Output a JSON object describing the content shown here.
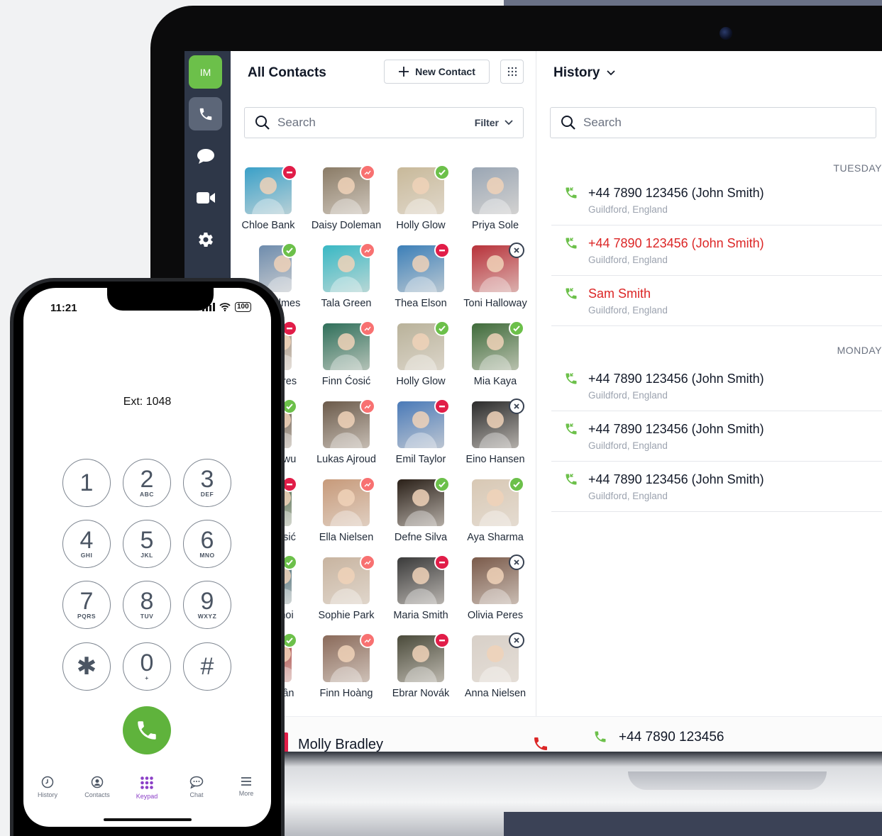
{
  "laptop": {
    "sidebar": {
      "user_initials": "IM",
      "items": [
        {
          "icon": "phone-icon",
          "active": true
        },
        {
          "icon": "chat-icon",
          "active": false
        },
        {
          "icon": "video-icon",
          "active": false
        },
        {
          "icon": "gear-icon",
          "active": false
        }
      ]
    },
    "contacts": {
      "title": "All Contacts",
      "new_contact_label": "New Contact",
      "search_placeholder": "Search",
      "filter_label": "Filter",
      "items": [
        {
          "name": "Chloe Bank",
          "status": "busy",
          "color": "#3aa0c8"
        },
        {
          "name": "Daisy Doleman",
          "status": "away",
          "color": "#8a7b66"
        },
        {
          "name": "Holly Glow",
          "status": "online",
          "color": "#c8b99a"
        },
        {
          "name": "Priya Sole",
          "status": "none",
          "color": "#9aa6b4"
        },
        {
          "name": "olmes",
          "status": "online",
          "color": "#6e8cad"
        },
        {
          "name": "Tala Green",
          "status": "away",
          "color": "#39b8c4"
        },
        {
          "name": "Thea Elson",
          "status": "busy",
          "color": "#3c7fb8"
        },
        {
          "name": "Toni Halloway",
          "status": "off",
          "color": "#b8323a"
        },
        {
          "name": "eres",
          "status": "busy",
          "color": "#9c8a78"
        },
        {
          "name": "Finn Ćosić",
          "status": "away",
          "color": "#2f6f5a"
        },
        {
          "name": "Holly Glow",
          "status": "online",
          "color": "#b9b29a"
        },
        {
          "name": "Mia Kaya",
          "status": "online",
          "color": "#3f6b3a"
        },
        {
          "name": "owu",
          "status": "online",
          "color": "#5a4a3a"
        },
        {
          "name": "Lukas Ajroud",
          "status": "away",
          "color": "#6b5a4a"
        },
        {
          "name": "Emil Taylor",
          "status": "busy",
          "color": "#4a7ab8"
        },
        {
          "name": "Eino Hansen",
          "status": "off",
          "color": "#2b2b2b"
        },
        {
          "name": "osić",
          "status": "busy",
          "color": "#3a5a3a"
        },
        {
          "name": "Ella Nielsen",
          "status": "away",
          "color": "#c79a7a"
        },
        {
          "name": "Defne Silva",
          "status": "online",
          "color": "#2a2018"
        },
        {
          "name": "Aya Sharma",
          "status": "online",
          "color": "#d8c8b4"
        },
        {
          "name": "hoi",
          "status": "online",
          "color": "#2f5a6a"
        },
        {
          "name": "Sophie Park",
          "status": "away",
          "color": "#c8b4a0"
        },
        {
          "name": "Maria Smith",
          "status": "busy",
          "color": "#3a3a3a"
        },
        {
          "name": "Olivia Peres",
          "status": "off",
          "color": "#7a5a4a"
        },
        {
          "name": "rần",
          "status": "online",
          "color": "#a02a2a"
        },
        {
          "name": "Finn Hoàng",
          "status": "away",
          "color": "#8a6a5a"
        },
        {
          "name": "Ebrar Novák",
          "status": "busy",
          "color": "#4a4a3a"
        },
        {
          "name": "Anna Nielsen",
          "status": "off",
          "color": "#d8d0c8"
        }
      ]
    },
    "history": {
      "title": "History",
      "search_placeholder": "Search",
      "groups": [
        {
          "day": "TUESDAY",
          "calls": [
            {
              "number": "+44 7890 123456 (John Smith)",
              "location": "Guildford, England",
              "missed": false
            },
            {
              "number": "+44 7890 123456 (John Smith)",
              "location": "Guildford, England",
              "missed": true
            },
            {
              "number": "Sam Smith",
              "location": "Guildford, England",
              "missed": true
            }
          ]
        },
        {
          "day": "MONDAY",
          "calls": [
            {
              "number": "+44 7890 123456 (John Smith)",
              "location": "Guildford, England",
              "missed": false
            },
            {
              "number": "+44 7890 123456 (John Smith)",
              "location": "Guildford, England",
              "missed": false
            },
            {
              "number": "+44 7890 123456 (John Smith)",
              "location": "Guildford, England",
              "missed": false
            }
          ]
        }
      ]
    },
    "bottom": {
      "active_call_name": "Molly Bradley",
      "active_call_number": "+44 7890 123456"
    }
  },
  "phone": {
    "time": "11:21",
    "battery": "100",
    "extension": "Ext: 1048",
    "keys": [
      {
        "digit": "1",
        "letters": ""
      },
      {
        "digit": "2",
        "letters": "ABC"
      },
      {
        "digit": "3",
        "letters": "DEF"
      },
      {
        "digit": "4",
        "letters": "GHI"
      },
      {
        "digit": "5",
        "letters": "JKL"
      },
      {
        "digit": "6",
        "letters": "MNO"
      },
      {
        "digit": "7",
        "letters": "PQRS"
      },
      {
        "digit": "8",
        "letters": "TUV"
      },
      {
        "digit": "9",
        "letters": "WXYZ"
      },
      {
        "digit": "✱",
        "letters": ""
      },
      {
        "digit": "0",
        "letters": "+"
      },
      {
        "digit": "#",
        "letters": ""
      }
    ],
    "tabs": [
      {
        "label": "History",
        "icon": "clock-icon",
        "active": false
      },
      {
        "label": "Contacts",
        "icon": "person-icon",
        "active": false
      },
      {
        "label": "Keypad",
        "icon": "keypad-icon",
        "active": true
      },
      {
        "label": "Chat",
        "icon": "chat-bubble-icon",
        "active": false
      },
      {
        "label": "More",
        "icon": "menu-icon",
        "active": false
      }
    ],
    "accent_color": "#8b3fc7",
    "call_button_color": "#5fb33c"
  }
}
